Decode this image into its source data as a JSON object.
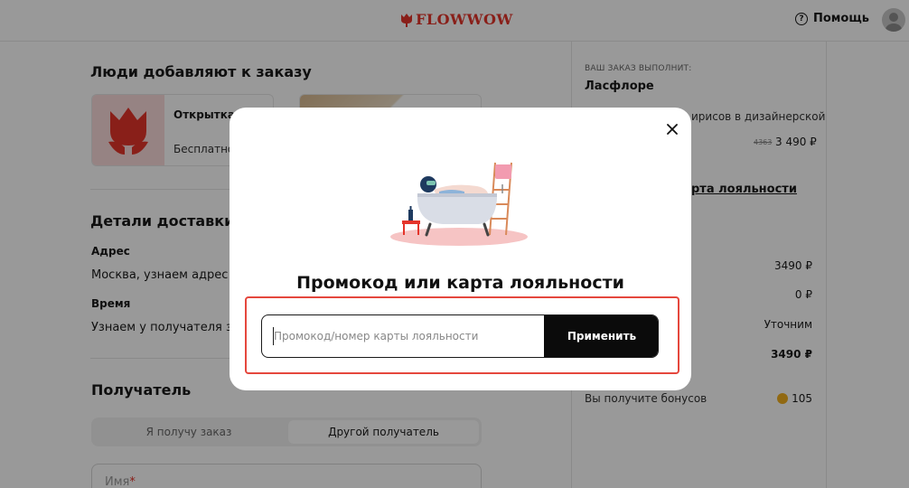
{
  "header": {
    "logo_text": "FLOWWOW",
    "help_label": "Помощь",
    "help_icon_glyph": "?"
  },
  "upsell": {
    "title": "Люди добавляют к заказу",
    "card1": {
      "title": "Открытка",
      "subtitle": "Бесплатно"
    }
  },
  "delivery": {
    "title": "Детали доставки",
    "address_label": "Адрес",
    "address_value": "Москва, узнаем адрес у",
    "time_label": "Время",
    "time_value": "Узнаем у получателя за"
  },
  "recipient": {
    "title": "Получатель",
    "options": [
      "Я получу заказ",
      "Другой получатель"
    ],
    "selected": "Другой получатель",
    "name_label": "Имя",
    "required_mark": "*"
  },
  "summary": {
    "performer_caption": "ВАШ ЗАКАЗ ВЫПОЛНИТ:",
    "shop_name": "Ласфлоре",
    "item_text": "ирисов в дизайнерской",
    "old_price": "4363",
    "price": "3 490 ₽",
    "loyalty_link": "рта лояльности",
    "rows": [
      "3490 ₽",
      "0 ₽",
      "Уточним",
      "3490 ₽"
    ],
    "bonus_label": "Вы получите бонусов",
    "bonus_value": "105"
  },
  "modal": {
    "title": "Промокод или карта лояльности",
    "input_placeholder": "Промокод/номер карты лояльности",
    "input_value": "",
    "apply_label": "Применить"
  },
  "colors": {
    "brand": "#e4352b",
    "button": "#0b0b0b",
    "highlight": "#e5473d",
    "bonus": "#f2b01e"
  },
  "icons": [
    "tulip-logo-icon",
    "help-icon",
    "avatar-icon",
    "close-icon",
    "tulip-icon",
    "bathtub-illustration"
  ]
}
